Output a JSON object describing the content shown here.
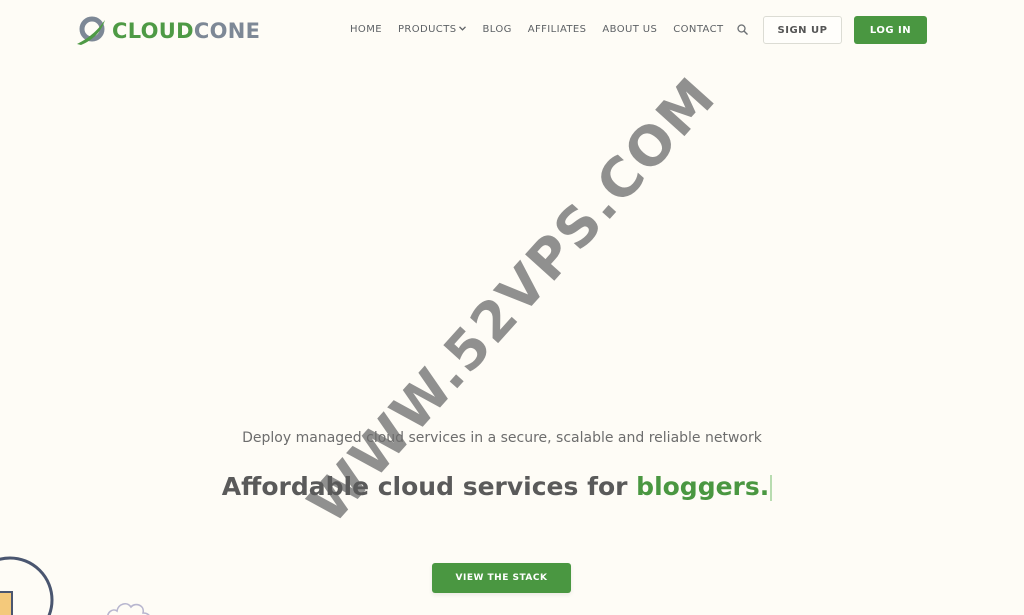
{
  "brand": {
    "name_part1": "CLOUD",
    "name_part2": "CONE",
    "colors": {
      "green": "#4a9741",
      "gray": "#7d8896"
    }
  },
  "nav": {
    "items": [
      {
        "label": "HOME"
      },
      {
        "label": "PRODUCTS",
        "has_dropdown": true
      },
      {
        "label": "BLOG"
      },
      {
        "label": "AFFILIATES"
      },
      {
        "label": "ABOUT US"
      },
      {
        "label": "CONTACT"
      }
    ],
    "search_icon": "search-icon",
    "signup_label": "SIGN UP",
    "login_label": "LOG IN"
  },
  "hero": {
    "subtitle": "Deploy managed cloud services in a secure, scalable and reliable network",
    "headline_prefix": "Affordable cloud services for ",
    "headline_accent": "bloggers.",
    "cta_label": "VIEW THE STACK"
  },
  "watermark": "WWW.52VPS.COM"
}
